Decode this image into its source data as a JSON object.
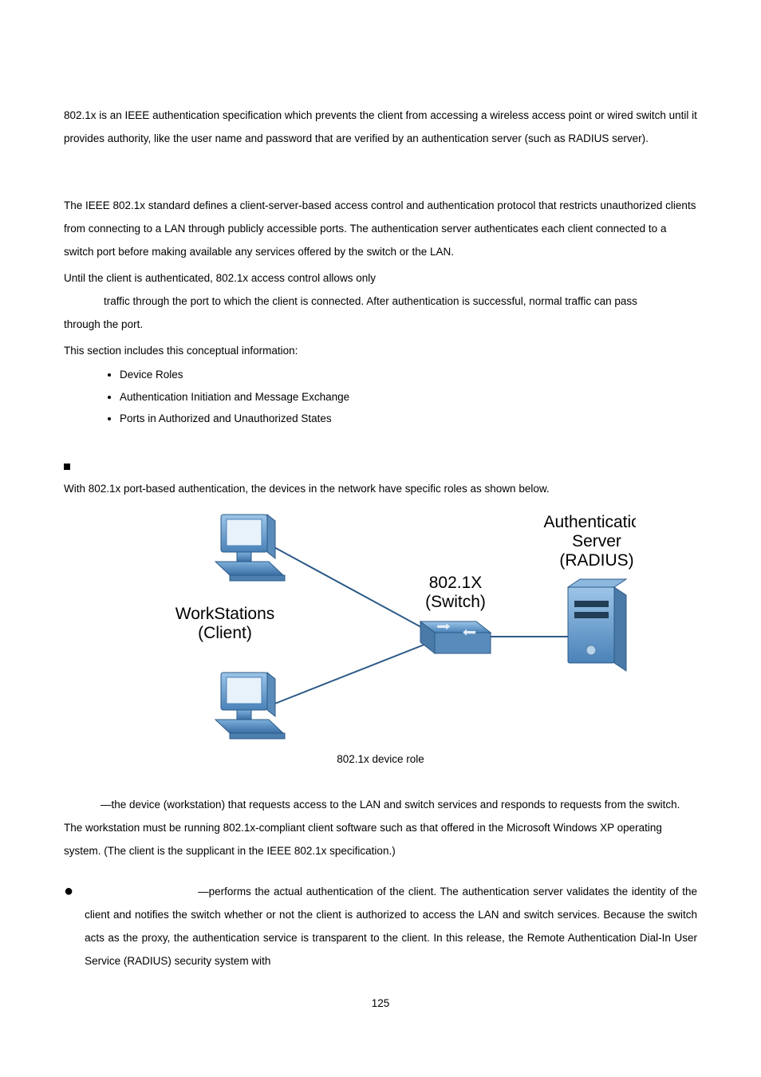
{
  "p1": "802.1x is an IEEE authentication specification which prevents the client from accessing a wireless access point or wired switch until it provides authority, like the user name and password that are verified by an authentication server (such as RADIUS server).",
  "p2": "The IEEE 802.1x standard defines a client-server-based access control and authentication protocol that restricts unauthorized clients from connecting to a LAN through publicly accessible ports. The authentication server authenticates each client connected to a switch port before making available any services offered by the switch or the LAN.",
  "p3a": "Until the client is authenticated, 802.1x access control allows only",
  "p3b_indent": "traffic through the port to which the client is connected. After authentication is successful, normal traffic can pass",
  "p3c": "through the port.",
  "p4": "This section includes this conceptual information:",
  "list": [
    "Device Roles",
    "Authentication Initiation and Message Exchange",
    "Ports in Authorized and Unauthorized States"
  ],
  "p5": "With 802.1x port-based authentication, the devices in the network have specific roles as shown below.",
  "figure": {
    "workstations_l1": "WorkStations",
    "workstations_l2": "(Client)",
    "switch_l1": "802.1X",
    "switch_l2": "(Switch)",
    "server_l1": "Authentication",
    "server_l2": "Server",
    "server_l3": "(RADIUS)"
  },
  "caption": "802.1x device role",
  "p6": "—the device (workstation) that requests access to the LAN and switch services and responds to requests from the switch. The workstation must be running 802.1x-compliant client software such as that offered in the Microsoft Windows XP operating system. (The client is the supplicant in the IEEE 802.1x specification.)",
  "p7": "—performs the actual authentication of the client. The authentication server validates the identity of the client and notifies the switch whether or not the client is authorized to access the LAN and switch services. Because the switch acts as the proxy, the authentication service is transparent to the client. In this release, the Remote Authentication Dial-In User Service (RADIUS) security system with",
  "page_number": "125"
}
